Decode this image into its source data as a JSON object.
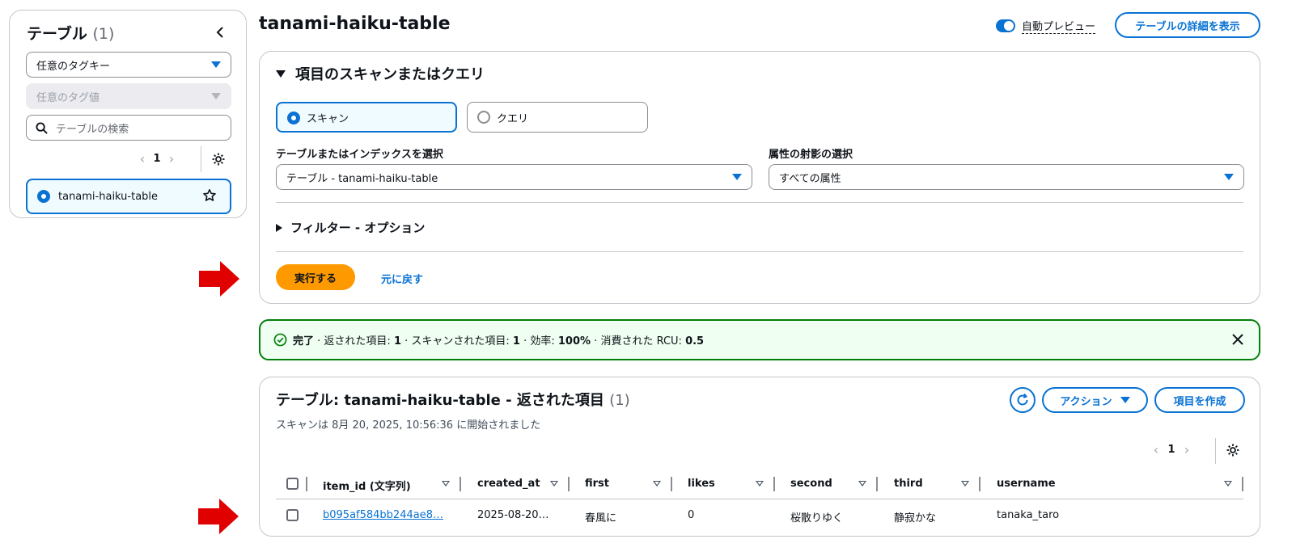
{
  "left_panel": {
    "title": "テーブル",
    "count": "(1)",
    "tag_key_placeholder": "任意のタグキー",
    "tag_value_placeholder": "任意のタグ値",
    "search_placeholder": "テーブルの検索",
    "page": "1",
    "table_name": "tanami-haiku-table"
  },
  "header": {
    "title": "tanami-haiku-table",
    "auto_preview_label": "自動プレビュー",
    "view_details_label": "テーブルの詳細を表示"
  },
  "scan": {
    "section_title": "項目のスキャンまたはクエリ",
    "scan_label": "スキャン",
    "query_label": "クエリ",
    "table_select_label": "テーブルまたはインデックスを選択",
    "table_select_value": "テーブル - tanami-haiku-table",
    "projection_label": "属性の射影の選択",
    "projection_value": "すべての属性",
    "filter_title": "フィルター - オプション",
    "run_label": "実行する",
    "reset_label": "元に戻す"
  },
  "flash": {
    "status": "完了",
    "returned_label": " · 返された項目: ",
    "returned_value": "1",
    "scanned_label": " · スキャンされた項目: ",
    "scanned_value": "1",
    "efficiency_label": " · 効率: ",
    "efficiency_value": "100%",
    "rcu_label": " · 消費された RCU: ",
    "rcu_value": "0.5"
  },
  "results": {
    "title": "テーブル: tanami-haiku-table - 返された項目",
    "count": "(1)",
    "subtitle": "スキャンは 8月 20, 2025, 10:56:36 に開始されました",
    "actions_label": "アクション",
    "create_label": "項目を作成",
    "page": "1",
    "columns": [
      "item_id (文字列)",
      "created_at",
      "first",
      "likes",
      "second",
      "third",
      "username"
    ],
    "rows": [
      {
        "item_id": "b095af584bb244ae8…",
        "created_at": "2025-08-20…",
        "first": "春風に",
        "likes": "0",
        "second": "桜散りゆく",
        "third": "静寂かな",
        "username": "tanaka_taro"
      }
    ]
  },
  "colors": {
    "accent": "#0972d3",
    "primary_button": "#ff9900",
    "success": "#037f0c",
    "arrow": "#e00000"
  }
}
